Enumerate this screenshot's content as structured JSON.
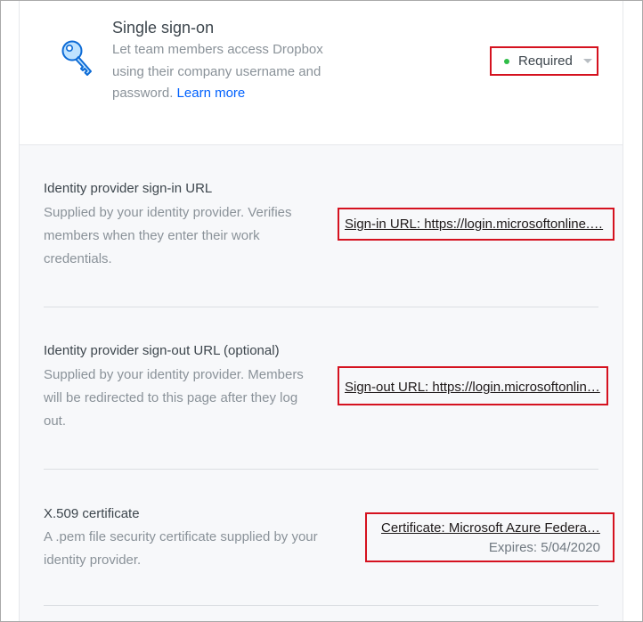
{
  "sso": {
    "title": "Single sign-on",
    "description": "Let team members access Dropbox using their company username and password.",
    "learn_more": "Learn more",
    "icon": "key-icon",
    "status": {
      "label": "Required",
      "dot_color": "#2fbd48"
    }
  },
  "settings": [
    {
      "title": "Identity provider sign-in URL",
      "description": "Supplied by your identity provider. Verifies members when they enter their work credentials.",
      "link": "Sign-in URL: https://login.microsoftonline.com/..."
    },
    {
      "title": "Identity provider sign-out URL (optional)",
      "description": "Supplied by your identity provider. Members will be redirected to this page after they log out.",
      "link": "Sign-out URL: https://login.microsoftonline.com/..."
    },
    {
      "title": "X.509 certificate",
      "description": "A .pem file security certificate supplied by your identity provider.",
      "link": "Certificate: Microsoft Azure Federated SSO Certificate",
      "expires": "Expires: 5/04/2020"
    }
  ],
  "colors": {
    "highlight_border": "#d5121f",
    "link_blue": "#0061fe"
  }
}
